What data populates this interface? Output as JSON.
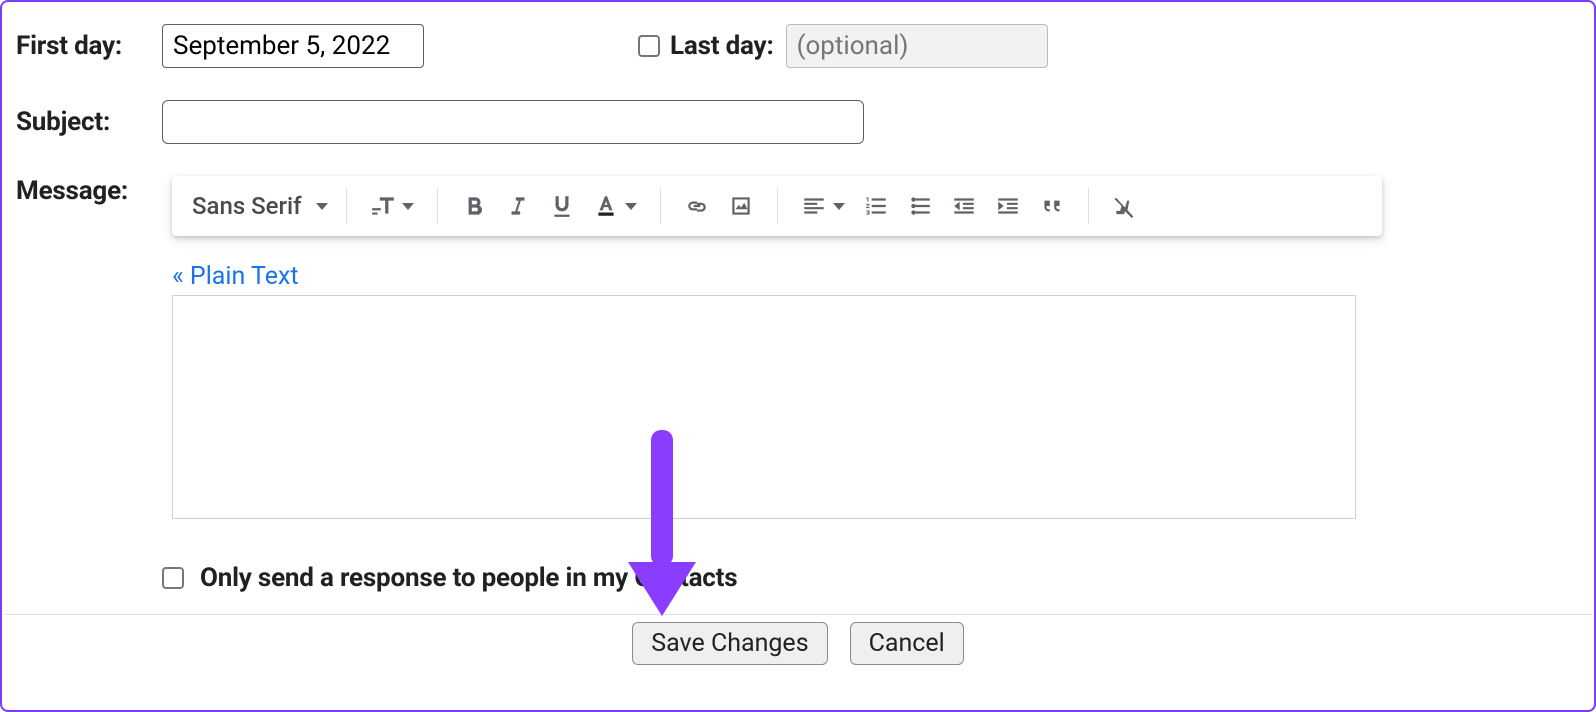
{
  "form": {
    "first_day_label": "First day:",
    "first_day_value": "September 5, 2022",
    "last_day_label": "Last day:",
    "last_day_placeholder": "(optional)",
    "subject_label": "Subject:",
    "subject_value": "",
    "message_label": "Message:",
    "contacts_only_label": "Only send a response to people in my Contacts"
  },
  "toolbar": {
    "font": "Sans Serif",
    "plain_text": "« Plain Text"
  },
  "footer": {
    "save": "Save Changes",
    "cancel": "Cancel"
  }
}
